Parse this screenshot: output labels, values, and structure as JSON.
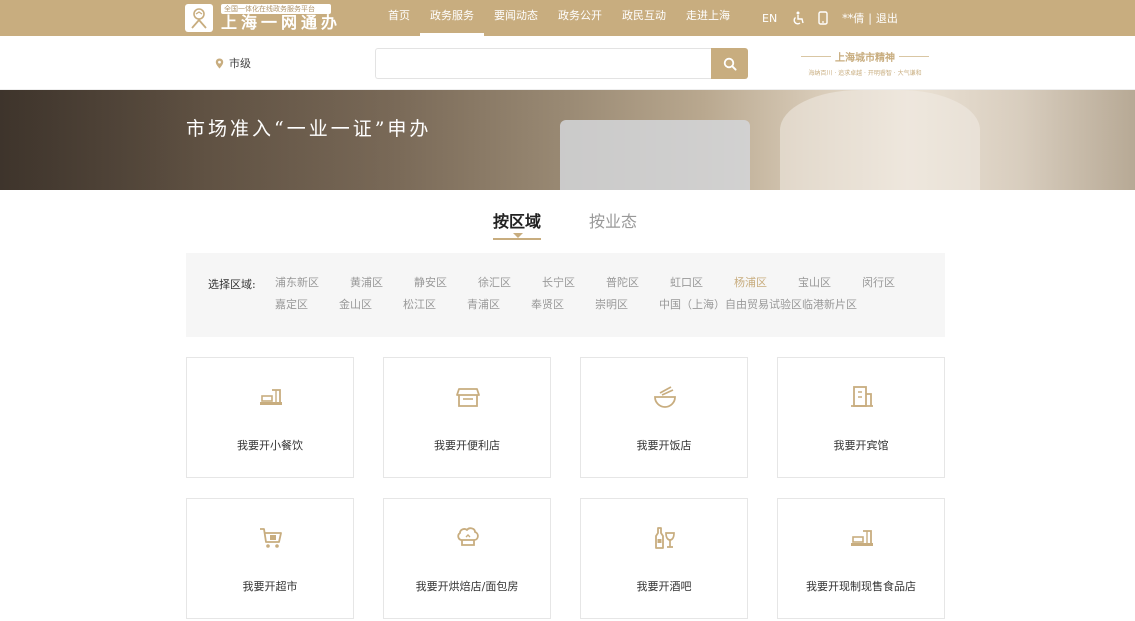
{
  "header": {
    "logo_tag": "全国一体化在线政务服务平台",
    "logo_name": "上海一网通办",
    "nav": [
      {
        "label": "首页",
        "active": false
      },
      {
        "label": "政务服务",
        "active": true
      },
      {
        "label": "要闻动态",
        "active": false
      },
      {
        "label": "政务公开",
        "active": false
      },
      {
        "label": "政民互动",
        "active": false
      },
      {
        "label": "走进上海",
        "active": false
      }
    ],
    "lang": "EN",
    "user": "**倩",
    "separator": "|",
    "logout": "退出"
  },
  "search": {
    "location": "市级",
    "placeholder": "",
    "value": ""
  },
  "spirit": {
    "title": "上海城市精神",
    "subtitle": "海纳百川 · 追求卓越 · 开明睿智 · 大气谦和"
  },
  "banner": {
    "title": "市场准入“一业一证”申办"
  },
  "tabs": [
    {
      "label": "按区域",
      "active": true
    },
    {
      "label": "按业态",
      "active": false
    }
  ],
  "regions": {
    "label": "选择区域:",
    "row1": [
      "浦东新区",
      "黄浦区",
      "静安区",
      "徐汇区",
      "长宁区",
      "普陀区",
      "虹口区",
      "杨浦区",
      "宝山区",
      "闵行区"
    ],
    "row2": [
      "嘉定区",
      "金山区",
      "松江区",
      "青浦区",
      "奉贤区",
      "崇明区",
      "中国（上海）自由贸易试验区临港新片区"
    ],
    "selected": "杨浦区"
  },
  "cards": [
    {
      "label": "我要开小餐饮",
      "icon": "noodle-bowl-icon"
    },
    {
      "label": "我要开便利店",
      "icon": "store-icon"
    },
    {
      "label": "我要开饭店",
      "icon": "rice-bowl-icon"
    },
    {
      "label": "我要开宾馆",
      "icon": "hotel-icon"
    },
    {
      "label": "我要开超市",
      "icon": "shopping-cart-icon"
    },
    {
      "label": "我要开烘焙店/面包房",
      "icon": "chef-hat-icon"
    },
    {
      "label": "我要开酒吧",
      "icon": "wine-bottle-icon"
    },
    {
      "label": "我要开现制现售食品店",
      "icon": "food-counter-icon"
    }
  ],
  "colors": {
    "accent": "#c8ad7f",
    "filter_bg": "#f6f6f6"
  }
}
